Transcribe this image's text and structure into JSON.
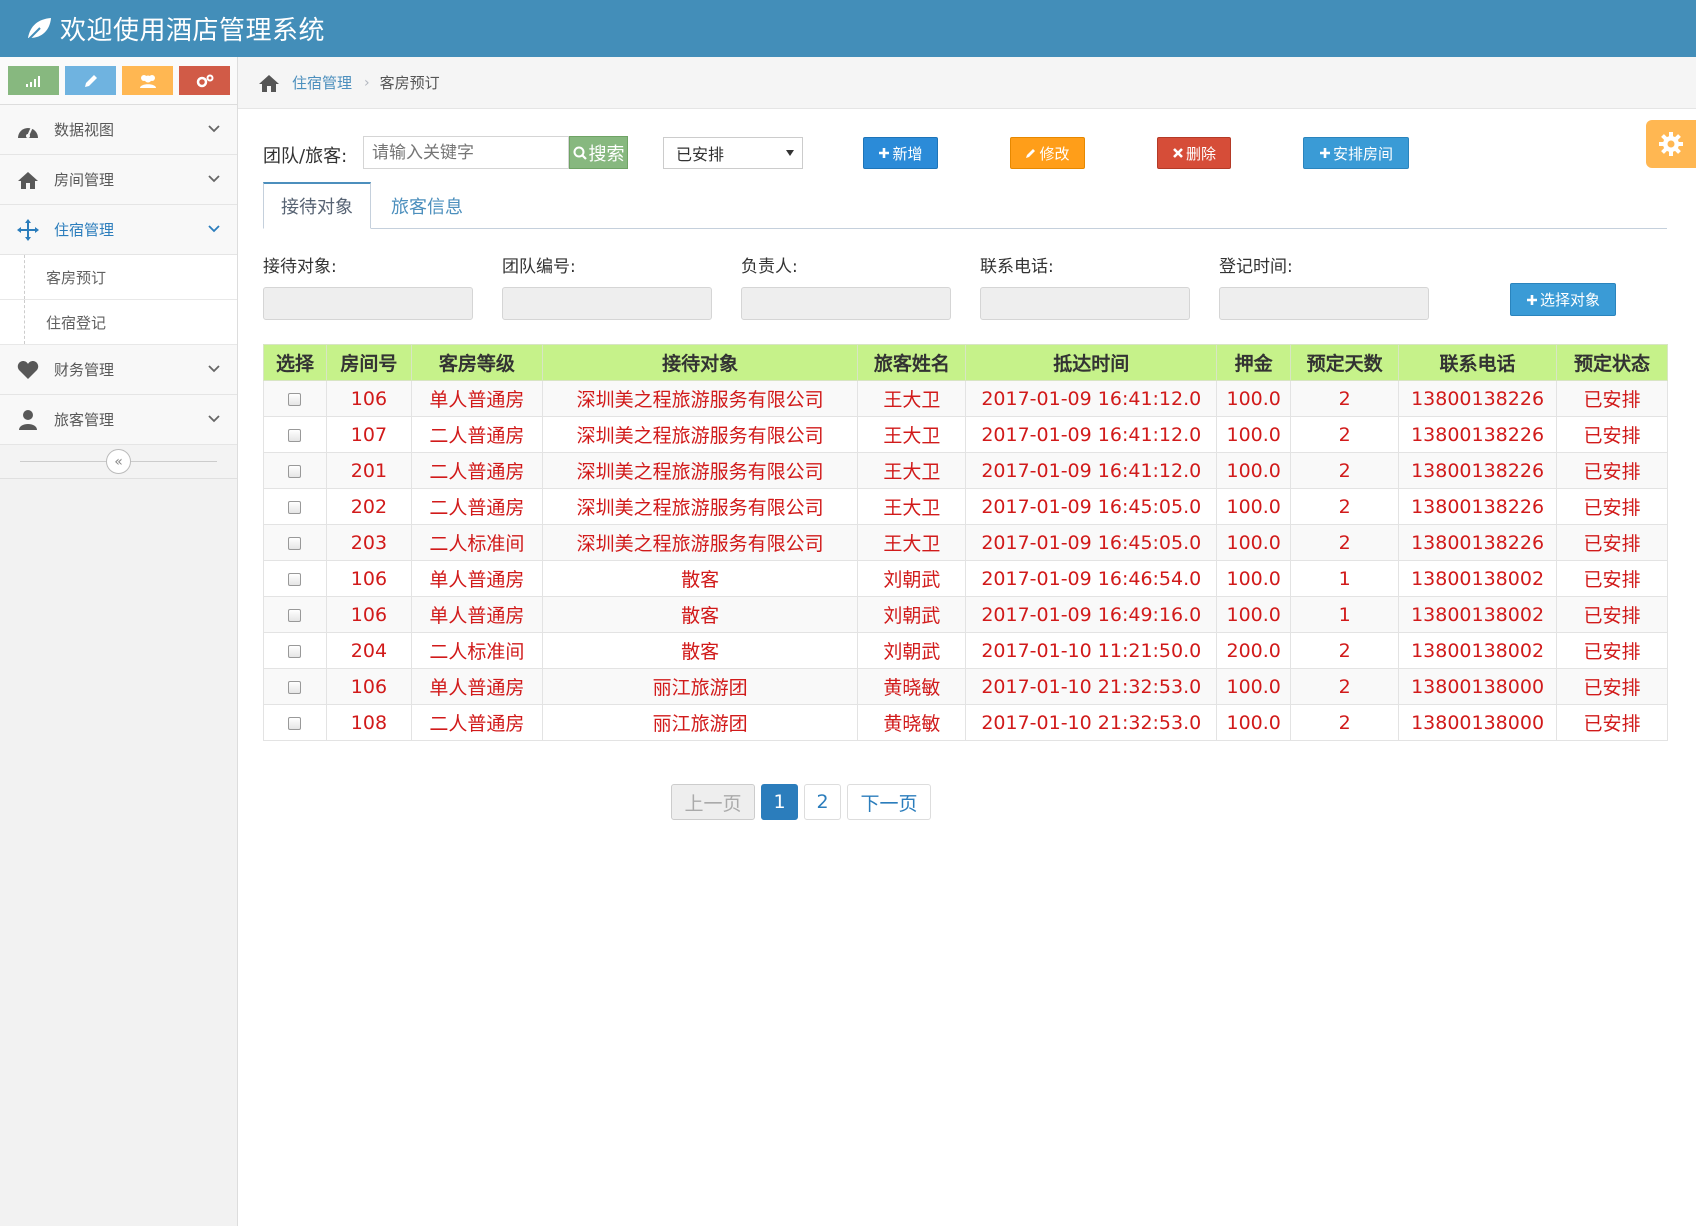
{
  "app": {
    "title": "欢迎使用酒店管理系统"
  },
  "sidebar": {
    "items": [
      {
        "label": "数据视图"
      },
      {
        "label": "房间管理"
      },
      {
        "label": "住宿管理"
      },
      {
        "label": "财务管理"
      },
      {
        "label": "旅客管理"
      }
    ],
    "subitems": [
      {
        "label": "客房预订"
      },
      {
        "label": "住宿登记"
      }
    ],
    "collapse_glyph": "«"
  },
  "breadcrumb": {
    "parent": "住宿管理",
    "current": "客房预订",
    "separator": "›"
  },
  "toolbar": {
    "search_label": "团队/旅客:",
    "search_placeholder": "请输入关键字",
    "search_button": "搜索",
    "status_value": "已安排",
    "add_button": "新增",
    "edit_button": "修改",
    "delete_button": "删除",
    "arrange_button": "安排房间"
  },
  "tabs": {
    "active": "接待对象",
    "inactive": "旅客信息"
  },
  "form": {
    "reception": "接待对象:",
    "team_no": "团队编号:",
    "leader": "负责人:",
    "phone": "联系电话:",
    "reg_time": "登记时间:",
    "select_button": "选择对象"
  },
  "table": {
    "headers": [
      "选择",
      "房间号",
      "客房等级",
      "接待对象",
      "旅客姓名",
      "抵达时间",
      "押金",
      "预定天数",
      "联系电话",
      "预定状态"
    ],
    "rows": [
      [
        "106",
        "单人普通房",
        "深圳美之程旅游服务有限公司",
        "王大卫",
        "2017-01-09 16:41:12.0",
        "100.0",
        "2",
        "13800138226",
        "已安排"
      ],
      [
        "107",
        "二人普通房",
        "深圳美之程旅游服务有限公司",
        "王大卫",
        "2017-01-09 16:41:12.0",
        "100.0",
        "2",
        "13800138226",
        "已安排"
      ],
      [
        "201",
        "二人普通房",
        "深圳美之程旅游服务有限公司",
        "王大卫",
        "2017-01-09 16:41:12.0",
        "100.0",
        "2",
        "13800138226",
        "已安排"
      ],
      [
        "202",
        "二人普通房",
        "深圳美之程旅游服务有限公司",
        "王大卫",
        "2017-01-09 16:45:05.0",
        "100.0",
        "2",
        "13800138226",
        "已安排"
      ],
      [
        "203",
        "二人标准间",
        "深圳美之程旅游服务有限公司",
        "王大卫",
        "2017-01-09 16:45:05.0",
        "100.0",
        "2",
        "13800138226",
        "已安排"
      ],
      [
        "106",
        "单人普通房",
        "散客",
        "刘朝武",
        "2017-01-09 16:46:54.0",
        "100.0",
        "1",
        "13800138002",
        "已安排"
      ],
      [
        "106",
        "单人普通房",
        "散客",
        "刘朝武",
        "2017-01-09 16:49:16.0",
        "100.0",
        "1",
        "13800138002",
        "已安排"
      ],
      [
        "204",
        "二人标准间",
        "散客",
        "刘朝武",
        "2017-01-10 11:21:50.0",
        "200.0",
        "2",
        "13800138002",
        "已安排"
      ],
      [
        "106",
        "单人普通房",
        "丽江旅游团",
        "黄晓敏",
        "2017-01-10 21:32:53.0",
        "100.0",
        "2",
        "13800138000",
        "已安排"
      ],
      [
        "108",
        "二人普通房",
        "丽江旅游团",
        "黄晓敏",
        "2017-01-10 21:32:53.0",
        "100.0",
        "2",
        "13800138000",
        "已安排"
      ]
    ]
  },
  "pagination": {
    "prev": "上一页",
    "page1": "1",
    "page2": "2",
    "next": "下一页"
  },
  "colors": {
    "header_bg": "#438eb9",
    "table_header_bg": "#c6f28a",
    "table_text": "#d11a1a",
    "accent": "#2b7dbc"
  }
}
